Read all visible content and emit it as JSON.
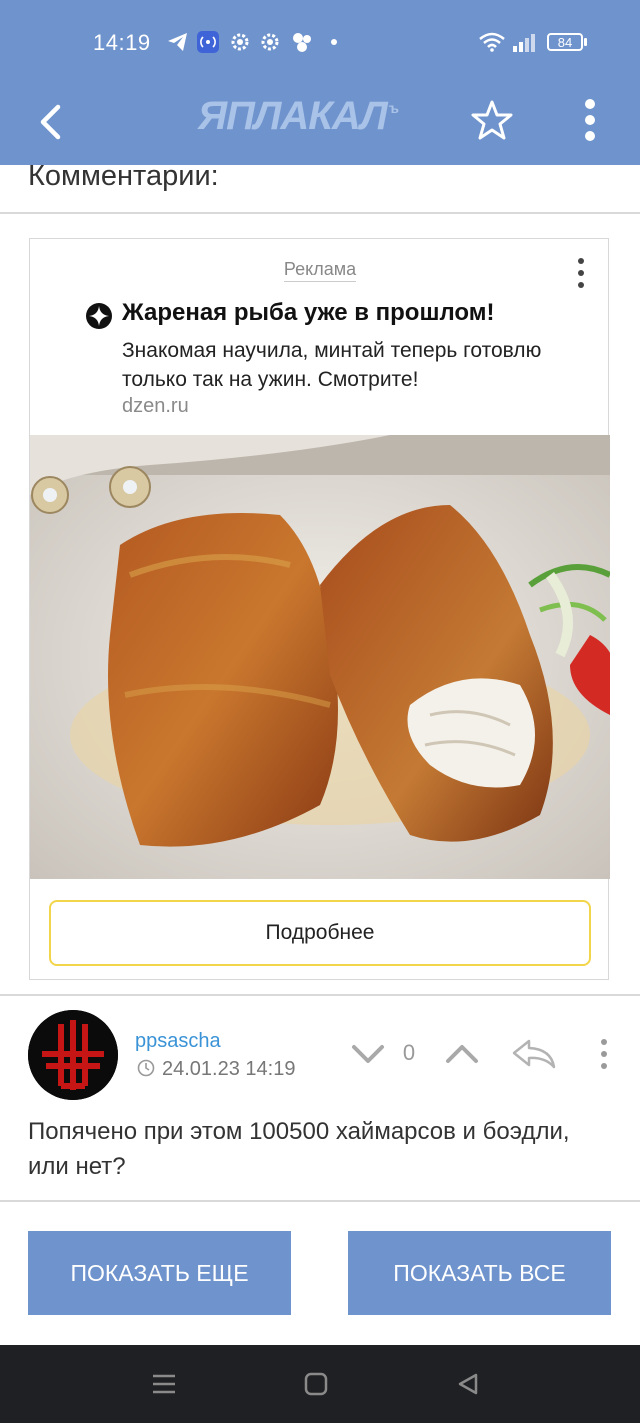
{
  "status_bar": {
    "time": "14:19",
    "battery": "84",
    "icons": [
      "telegram-icon",
      "nfc-icon",
      "gear-icon",
      "gear-icon",
      "cluster-icon",
      "dot-icon",
      "wifi-icon",
      "signal-icon",
      "battery-icon"
    ]
  },
  "app_bar": {
    "logo_text": "ЯПЛАКАЛ",
    "logo_sup": "ъ",
    "back_icon": "back-arrow-icon",
    "favorite_icon": "star-icon",
    "menu_icon": "kebab-menu-icon"
  },
  "comments_header": "Комментарии:",
  "ad": {
    "label": "Реклама",
    "title": "Жареная рыба уже в прошлом!",
    "description": "Знакомая научила, минтай теперь готовлю только так на ужин. Смотрите!",
    "domain": "dzen.ru",
    "cta": "Подробнее",
    "cta_border_color": "#f2d54a"
  },
  "comment": {
    "username": "ppsascha",
    "date": "24.01.23 14:19",
    "votes": "0",
    "text": "Попячено при этом 100500 хаймарсов и боэдли, или нет?"
  },
  "buttons": {
    "show_more": "ПОКАЗАТЬ ЕЩЕ",
    "show_all": "ПОКАЗАТЬ ВСЕ"
  },
  "colors": {
    "accent": "#6f93cc",
    "username": "#3a93d6",
    "nav_bar": "#1f2023"
  }
}
